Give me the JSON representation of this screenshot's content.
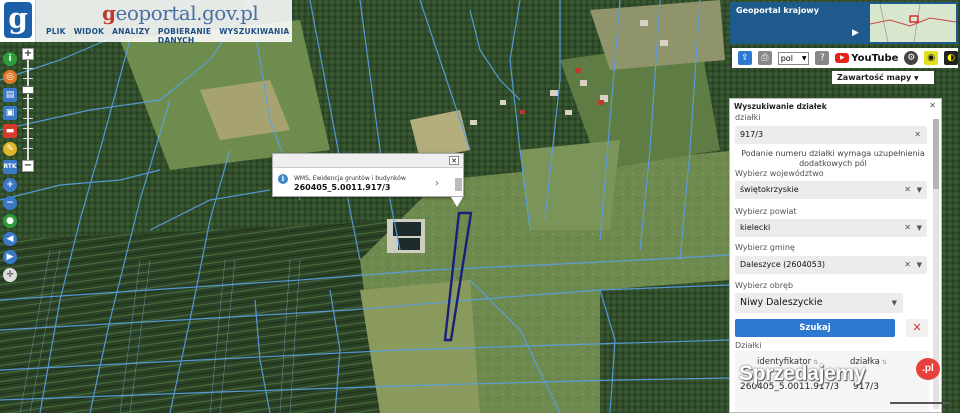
{
  "header": {
    "logo_letter": "g",
    "brand_accent": "g",
    "brand_rest": "eoportal.gov.pl",
    "menu": [
      "PLIK",
      "WIDOK",
      "ANALIZY",
      "POBIERANIE DANYCH",
      "WYSZUKIWANIA"
    ]
  },
  "overview": {
    "title": "Geoportal krajowy"
  },
  "top_tools": {
    "language": "pol",
    "youtube": "YouTube",
    "contents_button": "Zawartość mapy"
  },
  "popup": {
    "layer_name": "WMS, Ewidencja gruntów i budynków",
    "parcel_id": "260405_5.0011.917/3"
  },
  "search_panel": {
    "title": "Wyszukiwanie działek",
    "close": "✕",
    "parcels_label": "działki",
    "parcels_value": "917/3",
    "hint": "Podanie numeru działki wymaga uzupełnienia dodatkowych pól",
    "voivodeship_label": "Wybierz województwo",
    "voivodeship_value": "świętokrzyskie",
    "county_label": "Wybierz powiat",
    "county_value": "kielecki",
    "commune_label": "Wybierz gminę",
    "commune_value": "Daleszyce (2604053)",
    "precinct_label": "Wybierz obręb",
    "precinct_value": "Niwy Daleszyckie",
    "search_button": "Szukaj",
    "results_label": "Działki",
    "table_headers": [
      "identyfikator",
      "działka"
    ],
    "table_rows": [
      [
        "260405_5.0011.917/3",
        "917/3"
      ]
    ]
  },
  "watermark": {
    "text": "Sprzedajemy",
    "badge": ".pl"
  },
  "colors": {
    "accent_blue": "#2e78d2",
    "brand_blue": "#4a6fa5",
    "parcel_outline": "#1a1f7a",
    "boundary_lines": "#5aa0e6"
  }
}
